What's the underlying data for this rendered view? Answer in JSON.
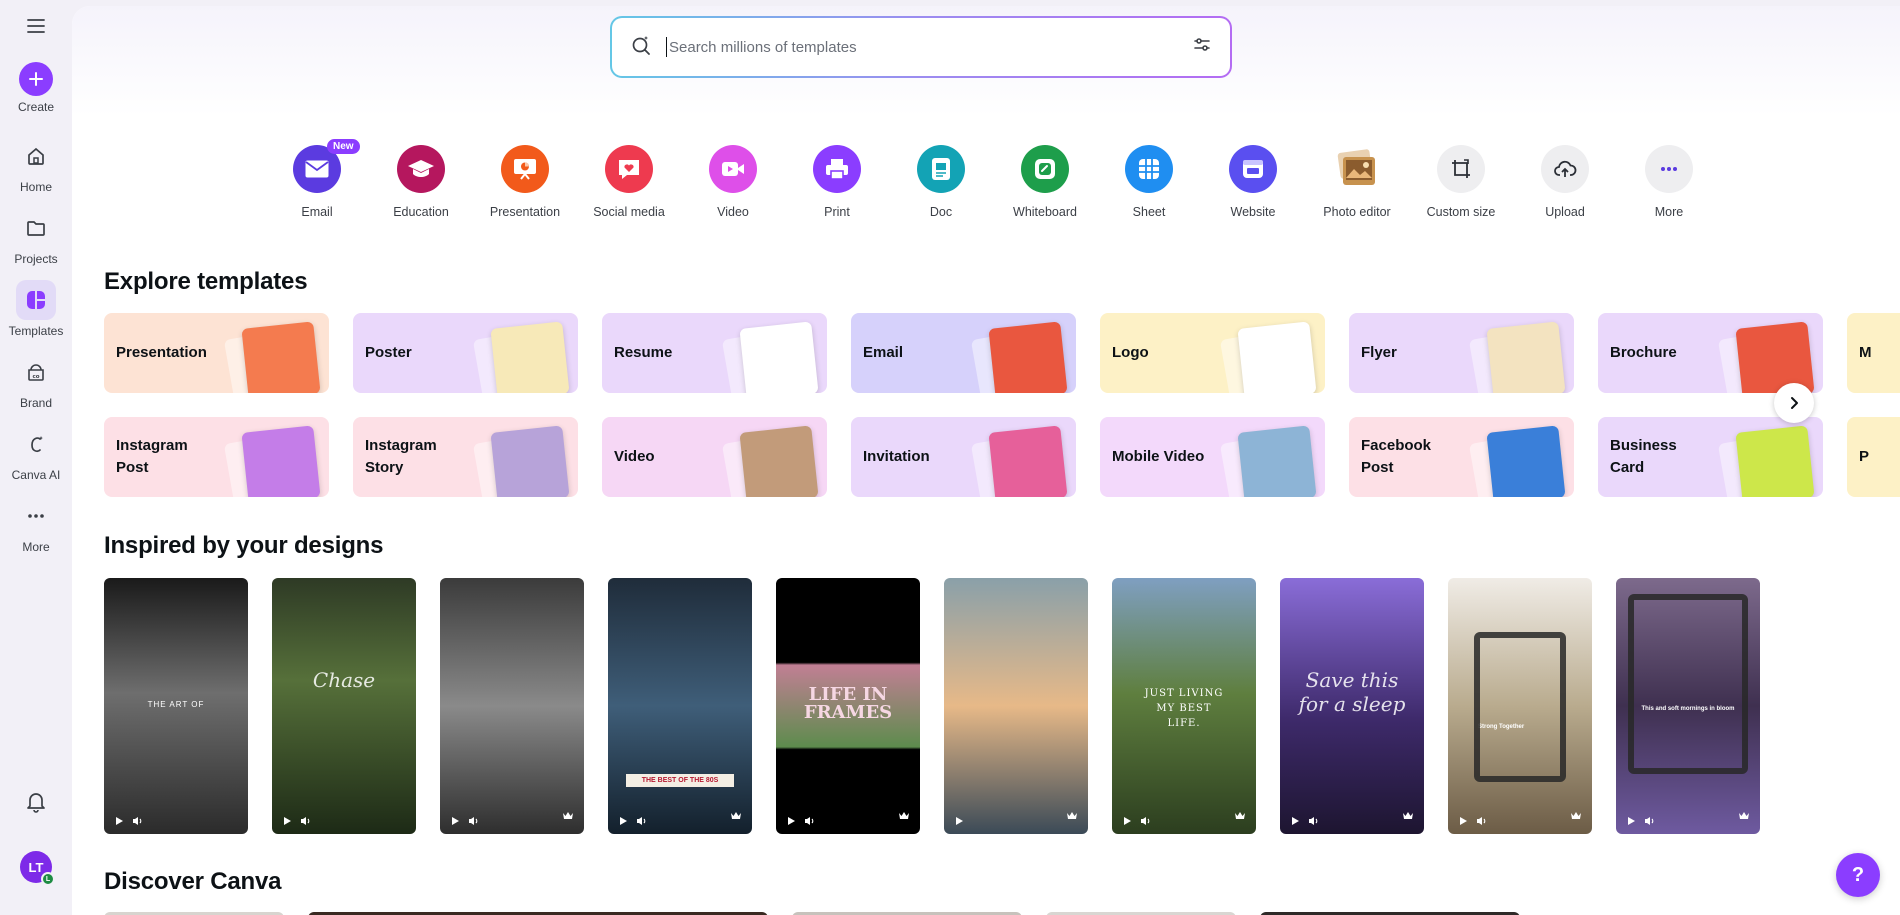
{
  "sidebar": {
    "items": [
      {
        "label": "Create",
        "icon": "plus-icon"
      },
      {
        "label": "Home",
        "icon": "home-icon"
      },
      {
        "label": "Projects",
        "icon": "folder-icon"
      },
      {
        "label": "Templates",
        "icon": "templates-icon"
      },
      {
        "label": "Brand",
        "icon": "brand-icon"
      },
      {
        "label": "Canva AI",
        "icon": "canva-ai-icon"
      },
      {
        "label": "More",
        "icon": "more-icon"
      }
    ],
    "avatar": {
      "initials": "LT",
      "badge": "L"
    }
  },
  "search": {
    "placeholder": "Search millions of templates"
  },
  "categories": [
    {
      "label": "Email",
      "color": "#5b3be0",
      "badge": "New"
    },
    {
      "label": "Education",
      "color": "#b5175e"
    },
    {
      "label": "Presentation",
      "color": "#f25a1b"
    },
    {
      "label": "Social media",
      "color": "#ee3a4f"
    },
    {
      "label": "Video",
      "color": "#de4fe9"
    },
    {
      "label": "Print",
      "color": "#8b3dff"
    },
    {
      "label": "Doc",
      "color": "#13a3b5"
    },
    {
      "label": "Whiteboard",
      "color": "#1e9e4b"
    },
    {
      "label": "Sheet",
      "color": "#1f8ef1"
    },
    {
      "label": "Website",
      "color": "#5a4ff0"
    },
    {
      "label": "Photo editor",
      "color": "#c7924e"
    },
    {
      "label": "Custom size",
      "color": "#eeeef0"
    },
    {
      "label": "Upload",
      "color": "#eeeef0"
    },
    {
      "label": "More",
      "color": "#eeeef0"
    }
  ],
  "sections": {
    "explore": "Explore templates",
    "inspired": "Inspired by your designs",
    "discover": "Discover Canva"
  },
  "templates_row1": [
    {
      "label": "Presentation",
      "bg": "#fde3d4",
      "thumb": "#f47b4f"
    },
    {
      "label": "Poster",
      "bg": "#ead8fb",
      "thumb": "#f7e9b8"
    },
    {
      "label": "Resume",
      "bg": "#ead8fb",
      "thumb": "#ffffff"
    },
    {
      "label": "Email",
      "bg": "#d6d1fb",
      "thumb": "#e9573f"
    },
    {
      "label": "Logo",
      "bg": "#fdf1c6",
      "thumb": "#ffffff"
    },
    {
      "label": "Flyer",
      "bg": "#ead8fb",
      "thumb": "#f3e3c0"
    },
    {
      "label": "Brochure",
      "bg": "#ead8fb",
      "thumb": "#e9573f"
    },
    {
      "label": "M",
      "bg": "#fdf1c6",
      "thumb": "#fdf1c6"
    }
  ],
  "templates_row2": [
    {
      "label": "Instagram Post",
      "bg": "#fde0e6",
      "thumb": "#c47de8"
    },
    {
      "label": "Instagram Story",
      "bg": "#fde0e6",
      "thumb": "#b7a3d9"
    },
    {
      "label": "Video",
      "bg": "#f6d7f5",
      "thumb": "#c29b7a"
    },
    {
      "label": "Invitation",
      "bg": "#ead8fb",
      "thumb": "#e6609a"
    },
    {
      "label": "Mobile Video",
      "bg": "#f3d9fb",
      "thumb": "#8db4d6"
    },
    {
      "label": "Facebook Post",
      "bg": "#fde0e6",
      "thumb": "#3a7fd9"
    },
    {
      "label": "Business Card",
      "bg": "#ead8fb",
      "thumb": "#cde74a"
    },
    {
      "label": "P",
      "bg": "#fdf1c6",
      "thumb": "#fdf1c6"
    }
  ],
  "designs": [
    {
      "text": "THE ART OF",
      "bg": "linear-gradient(180deg,#1a1a1a,#6e6e6e 45%,#2b2b2b)",
      "style": "small"
    },
    {
      "text": "Chase",
      "bg": "linear-gradient(180deg,#2e3a25,#56703a 40%,#1d2a16)",
      "style": "script"
    },
    {
      "text": "",
      "bg": "linear-gradient(180deg,#3b3b3b,#8a8a8a 50%,#2e2e2e)",
      "style": "none"
    },
    {
      "text": "THE BEST OF THE 80S",
      "bg": "linear-gradient(180deg,#1f2c3a,#3f5e79 50%,#13202c)",
      "style": "banner"
    },
    {
      "text": "LIFE IN FRAMES",
      "bg": "linear-gradient(180deg,#000,#000 33%,#c17f94 34%,#5d8c4d 66%,#000 67%)",
      "style": "big"
    },
    {
      "text": "",
      "bg": "linear-gradient(180deg,#8aa0a9,#e7b988 50%,#3b4a57)",
      "style": "none"
    },
    {
      "text": "JUST LIVING MY BEST LIFE.",
      "bg": "linear-gradient(180deg,#7f9fc1,#5f7f3f 45%,#2c3e1f)",
      "style": "serif"
    },
    {
      "text": "Save this for a sleep",
      "bg": "linear-gradient(180deg,#8a6dd8,#3e2a6b 55%,#1d1530)",
      "style": "script"
    },
    {
      "text": "Strong Together",
      "bg": "linear-gradient(180deg,#f0ece6,#b9ab8e 50%,#6c5c46)",
      "style": "player"
    },
    {
      "text": "This and soft mornings in bloom",
      "bg": "linear-gradient(180deg,#7d6a8c,#3f3050 50%,#6e5aa0)",
      "style": "player2"
    }
  ],
  "help": {
    "label": "?"
  }
}
